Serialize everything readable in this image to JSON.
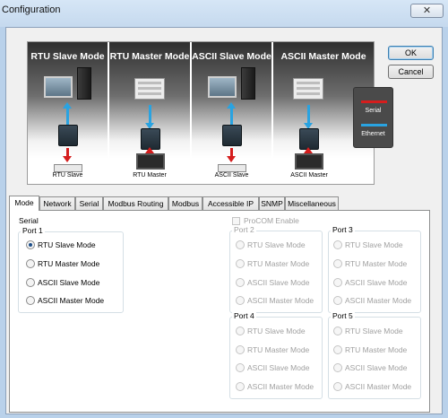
{
  "window": {
    "title": "Configuration",
    "close_glyph": "✕"
  },
  "banner": {
    "panels": [
      {
        "title": "RTU Slave Mode",
        "caption": "RTU Slave"
      },
      {
        "title": "RTU Master Mode",
        "caption": "RTU Master"
      },
      {
        "title": "ASCII Slave Mode",
        "caption": "ASCII Slave"
      },
      {
        "title": "ASCII Master Mode",
        "caption": "ASCII Master"
      }
    ],
    "legend": {
      "serial": "Serial",
      "ethernet": "Ethernet",
      "serial_color": "#d51d1d",
      "ethernet_color": "#29a3e1"
    }
  },
  "buttons": {
    "ok": "OK",
    "cancel": "Cancel"
  },
  "tabs": [
    "Mode",
    "Network",
    "Serial",
    "Modbus Routing",
    "Modbus",
    "Accessible IP",
    "SNMP",
    "Miscellaneous"
  ],
  "active_tab": "Mode",
  "mode_page": {
    "serial_label": "Serial",
    "procom_label": "ProCOM Enable",
    "procom_checked": false,
    "ports": [
      {
        "label": "Port 1",
        "enabled": true,
        "selected": "RTU Slave Mode"
      },
      {
        "label": "Port 2",
        "enabled": false
      },
      {
        "label": "Port 3",
        "enabled": false
      },
      {
        "label": "Port 4",
        "enabled": false
      },
      {
        "label": "Port 5",
        "enabled": false
      }
    ],
    "options": [
      "RTU Slave Mode",
      "RTU Master Mode",
      "ASCII Slave Mode",
      "ASCII Master Mode"
    ]
  }
}
